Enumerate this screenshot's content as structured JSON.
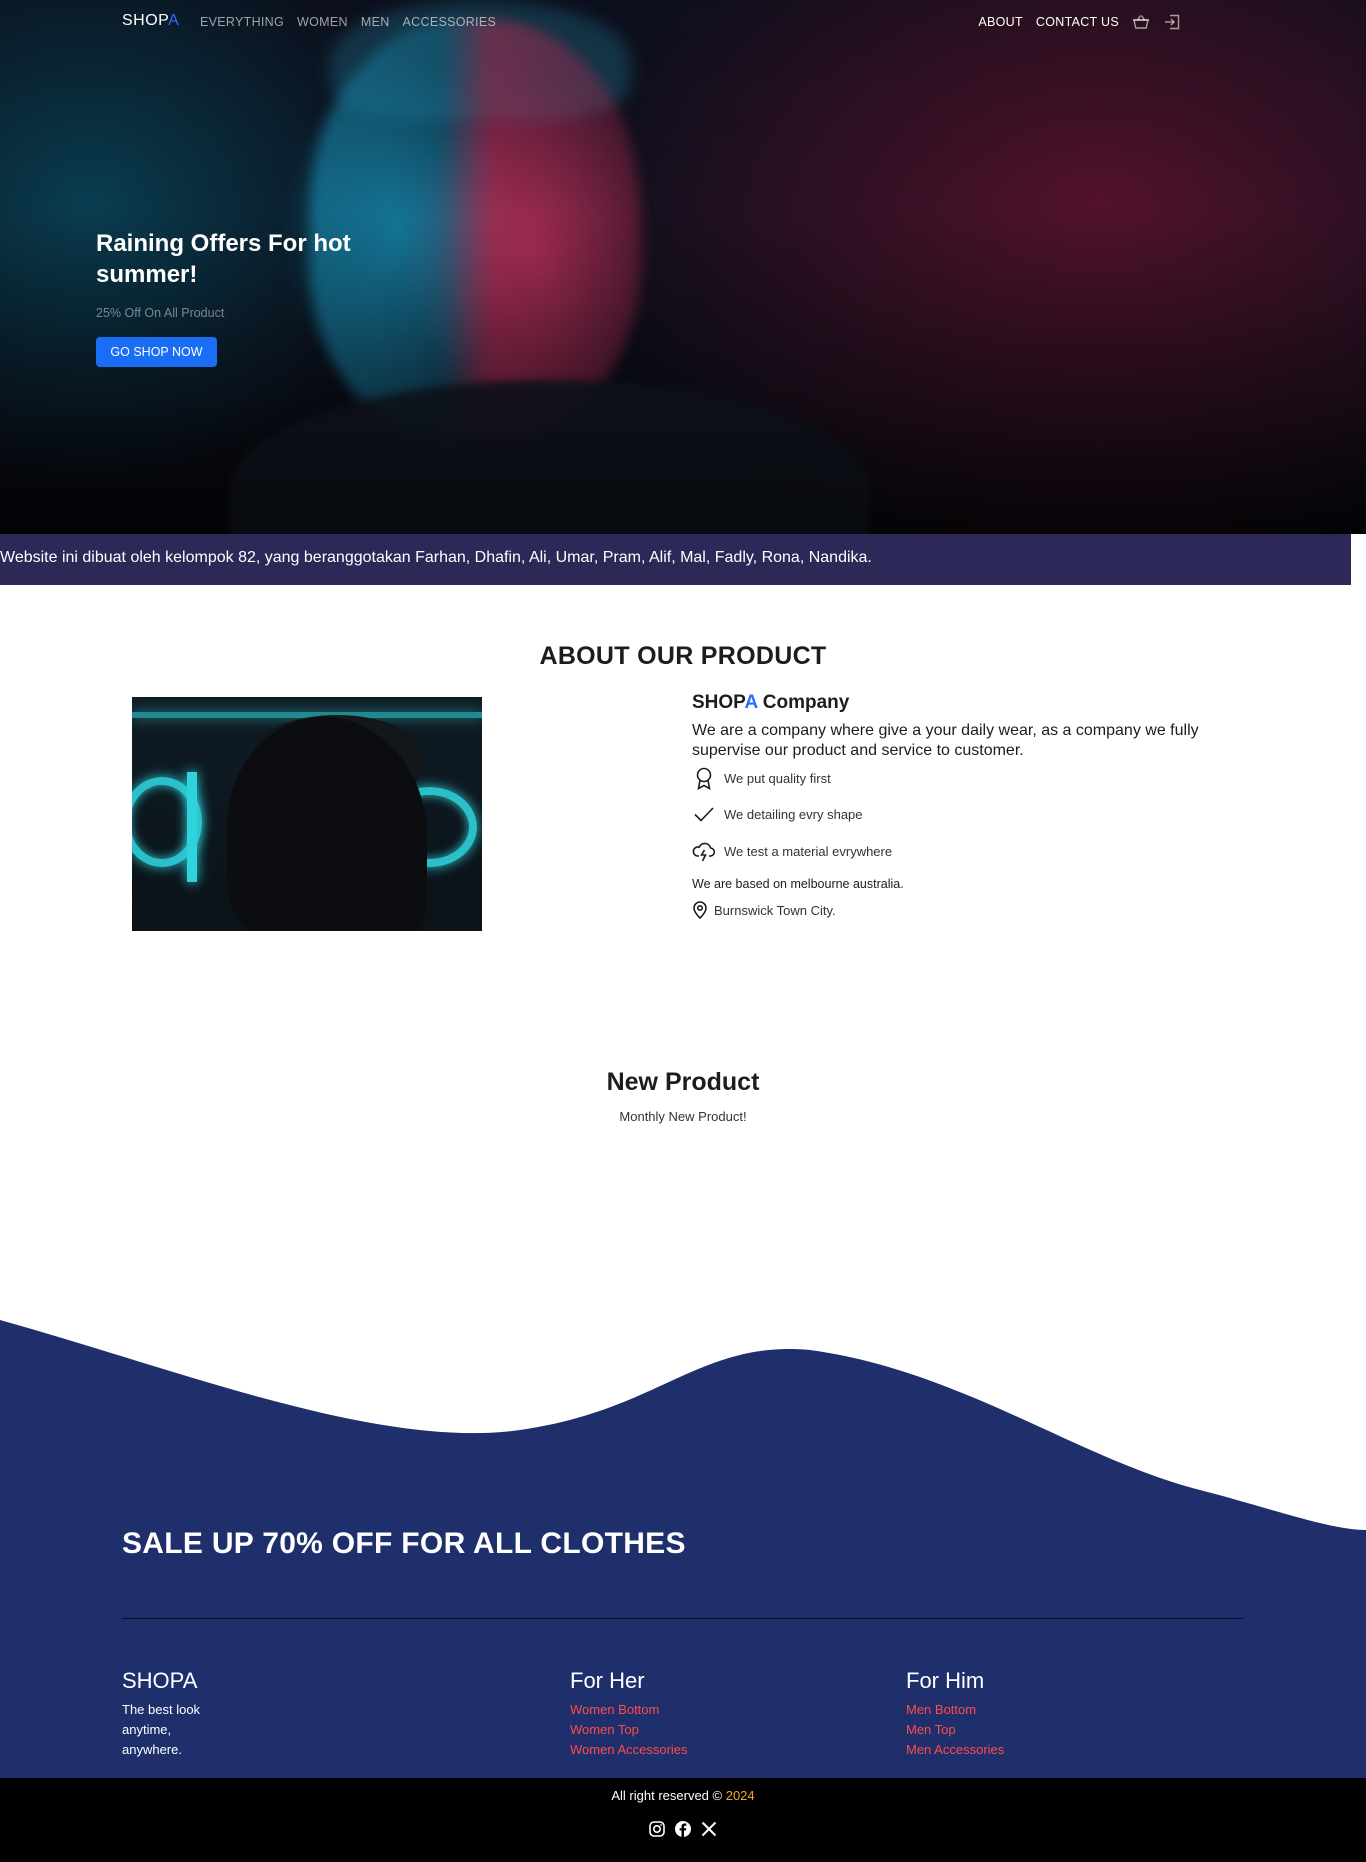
{
  "nav": {
    "brand_main": "SHOP",
    "brand_accent": "A",
    "left_links": [
      "EVERYTHING",
      "WOMEN",
      "MEN",
      "ACCESSORIES"
    ],
    "right_links": [
      "ABOUT",
      "CONTACT US"
    ],
    "icons": [
      "basket-icon",
      "login-icon"
    ]
  },
  "hero": {
    "title": "Raining Offers For hot summer!",
    "subtitle": "25% Off On All Product",
    "button_label": "GO SHOP NOW"
  },
  "credit_bar": {
    "text": "Website ini dibuat oleh kelompok 82, yang beranggotakan Farhan, Dhafin, Ali, Umar, Pram, Alif, Mal, Fadly, Rona, Nandika."
  },
  "about": {
    "title": "ABOUT OUR PRODUCT",
    "company_main": "SHOP",
    "company_accent": "A",
    "company_suffix": " Company",
    "description": "We are a company where give a your daily wear, as a company we fully supervise our product and service to customer.",
    "features": [
      {
        "icon": "award-icon",
        "text": "We put quality first"
      },
      {
        "icon": "check-icon",
        "text": "We detailing evry shape"
      },
      {
        "icon": "cloud-lightning-icon",
        "text": "We test a material evrywhere"
      }
    ],
    "based_text": "We are based on melbourne australia.",
    "location_icon": "map-pin-icon",
    "location_text": "Burnswick Town City."
  },
  "new_product": {
    "title": "New Product",
    "subtitle": "Monthly New Product!"
  },
  "footer": {
    "sale_text": "SALE UP 70% OFF FOR ALL CLOTHES",
    "brand_col": {
      "title": "SHOPA",
      "text": "The best look anytime, anywhere."
    },
    "her_col": {
      "title": "For Her",
      "links": [
        "Women Bottom",
        "Women Top",
        "Women Accessories"
      ]
    },
    "him_col": {
      "title": "For Him",
      "links": [
        "Men Bottom",
        "Men Top",
        "Men Accessories"
      ]
    },
    "copyright": "All right reserved ©",
    "year": "2024",
    "social_icons": [
      "instagram-icon",
      "facebook-icon",
      "x-icon"
    ]
  },
  "colors": {
    "accent_blue": "#2f6bff",
    "button_blue": "#1a6ef5",
    "credit_bar": "#2c2857",
    "footer_navy": "#1e2f6b",
    "footer_link_red": "#ff4b4b",
    "year_orange": "#f0a830"
  }
}
